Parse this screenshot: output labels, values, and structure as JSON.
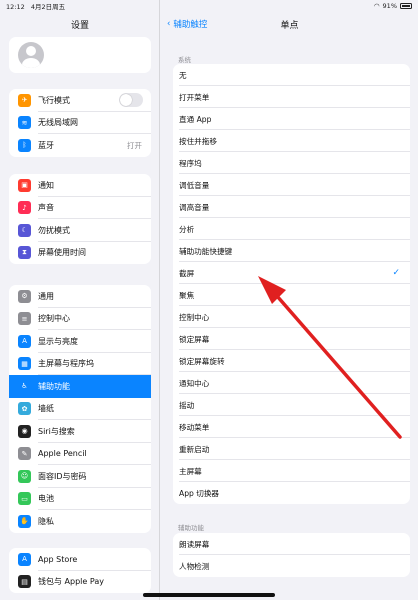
{
  "statusbar": {
    "time": "12:12",
    "date": "4月2日周五",
    "battery": "91%"
  },
  "sidebar": {
    "title": "设置",
    "groups": [
      {
        "items": [
          {
            "label": "飞行模式",
            "icon": "airplane-icon",
            "color": "#ff9500",
            "glyph": "✈",
            "toggle": true
          },
          {
            "label": "无线局域网",
            "icon": "wifi-icon",
            "color": "#0a84ff",
            "glyph": "≋",
            "value": ""
          },
          {
            "label": "蓝牙",
            "icon": "bluetooth-icon",
            "color": "#0a84ff",
            "glyph": "ᛒ",
            "value": "打开"
          }
        ]
      },
      {
        "items": [
          {
            "label": "通知",
            "icon": "notifications-icon",
            "color": "#ff3b30",
            "glyph": "▣"
          },
          {
            "label": "声音",
            "icon": "sound-icon",
            "color": "#ff2d55",
            "glyph": "♪"
          },
          {
            "label": "勿扰模式",
            "icon": "moon-icon",
            "color": "#5856d6",
            "glyph": "☾"
          },
          {
            "label": "屏幕使用时间",
            "icon": "hourglass-icon",
            "color": "#5856d6",
            "glyph": "⧗"
          }
        ]
      },
      {
        "items": [
          {
            "label": "通用",
            "icon": "gear-icon",
            "color": "#8e8e93",
            "glyph": "⚙"
          },
          {
            "label": "控制中心",
            "icon": "control-center-icon",
            "color": "#8e8e93",
            "glyph": "≡"
          },
          {
            "label": "显示与亮度",
            "icon": "display-icon",
            "color": "#0a84ff",
            "glyph": "A"
          },
          {
            "label": "主屏幕与程序坞",
            "icon": "home-screen-icon",
            "color": "#0a84ff",
            "glyph": "▦"
          },
          {
            "label": "辅助功能",
            "icon": "accessibility-icon",
            "color": "#0a84ff",
            "glyph": "♿",
            "selected": true
          },
          {
            "label": "墙纸",
            "icon": "wallpaper-icon",
            "color": "#34aadc",
            "glyph": "✿"
          },
          {
            "label": "Siri与搜索",
            "icon": "siri-icon",
            "color": "#222222",
            "glyph": "◉"
          },
          {
            "label": "Apple Pencil",
            "icon": "pencil-icon",
            "color": "#8e8e93",
            "glyph": "✎"
          },
          {
            "label": "面容ID与密码",
            "icon": "faceid-icon",
            "color": "#34c759",
            "glyph": "☺"
          },
          {
            "label": "电池",
            "icon": "battery-icon",
            "color": "#34c759",
            "glyph": "▭"
          },
          {
            "label": "隐私",
            "icon": "hand-icon",
            "color": "#0a84ff",
            "glyph": "✋"
          }
        ]
      },
      {
        "items": [
          {
            "label": "App Store",
            "icon": "appstore-icon",
            "color": "#0a84ff",
            "glyph": "A"
          },
          {
            "label": "钱包与 Apple Pay",
            "icon": "wallet-icon",
            "color": "#222222",
            "glyph": "▤"
          }
        ]
      }
    ]
  },
  "nav": {
    "back_label": "辅助触控",
    "title": "单点"
  },
  "sections": [
    {
      "header": "系统",
      "items": [
        "无",
        "打开菜单",
        "直通 App",
        "按住并拖移",
        "程序坞",
        "调低音量",
        "调高音量",
        "分析",
        "辅助功能快捷键",
        "截屏",
        "聚焦",
        "控制中心",
        "锁定屏幕",
        "锁定屏幕旋转",
        "通知中心",
        "摇动",
        "移动菜单",
        "重新启动",
        "主屏幕",
        "App 切换器"
      ],
      "checked_index": 9
    },
    {
      "header": "辅助功能",
      "items": [
        "朗读屏幕",
        "人物检测"
      ]
    }
  ],
  "colors": {
    "accent": "#0a84ff",
    "arrow": "#e02020"
  }
}
